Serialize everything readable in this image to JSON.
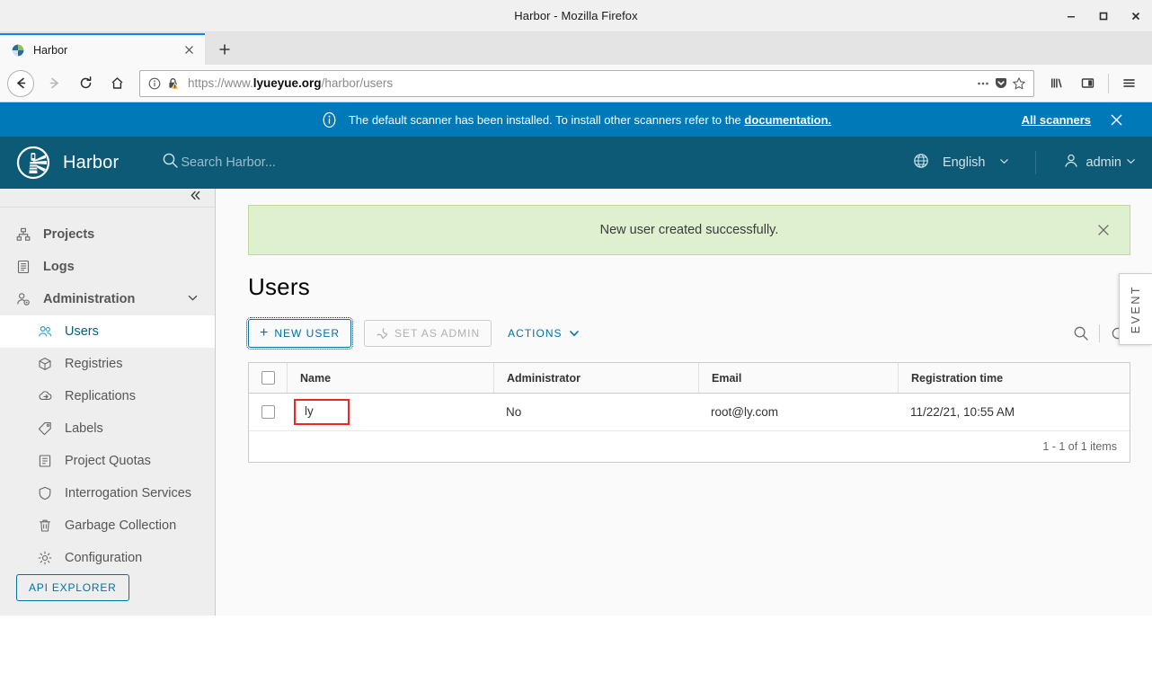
{
  "browser": {
    "window_title": "Harbor - Mozilla Firefox",
    "tab_label": "Harbor",
    "url_scheme": "https://www.",
    "url_host": "lyueyue.org",
    "url_path": "/harbor/users",
    "controls": {
      "minimize": "minimize-icon",
      "maximize": "maximize-icon",
      "close": "close-icon"
    },
    "nav": {
      "back": "back-arrow-icon",
      "forward": "forward-arrow-icon",
      "reload": "reload-icon",
      "home": "home-icon",
      "page_info": "info-icon",
      "lock_warning": "lock-warning-icon",
      "page_actions": "ellipsis-icon",
      "pocket": "pocket-icon",
      "bookmark": "star-icon",
      "library": "library-icon",
      "sidebar": "sidebar-icon",
      "menu": "hamburger-menu-icon"
    },
    "new_tab": "plus-icon",
    "tab_close": "close-icon"
  },
  "banner": {
    "message_prefix": "The default scanner has been installed. To install other scanners refer to the ",
    "link_text": "documentation.",
    "all_scanners": "All scanners",
    "close": "close-icon",
    "icon": "info-circle-icon",
    "bg_color": "#0079b8"
  },
  "header": {
    "brand": "Harbor",
    "logo": "harbor-lighthouse-logo",
    "search_placeholder": "Search Harbor...",
    "search_icon": "search-icon",
    "language": "English",
    "language_icon": "globe-icon",
    "language_chevron": "chevron-down-icon",
    "user": "admin",
    "user_icon": "user-icon",
    "user_chevron": "chevron-down-icon",
    "bg_color": "#0d5a76"
  },
  "event_tab": {
    "label": "EVENT"
  },
  "sidebar": {
    "collapse_icon": "double-chevron-left-icon",
    "items": [
      {
        "label": "Projects",
        "icon": "projects-icon",
        "level": "top",
        "active": false
      },
      {
        "label": "Logs",
        "icon": "logs-icon",
        "level": "top",
        "active": false
      },
      {
        "label": "Administration",
        "icon": "administration-icon",
        "level": "top",
        "active": false,
        "expanded": true,
        "chevron": "chevron-down-icon"
      },
      {
        "label": "Users",
        "icon": "users-icon",
        "level": "sub",
        "active": true
      },
      {
        "label": "Registries",
        "icon": "registries-icon",
        "level": "sub",
        "active": false
      },
      {
        "label": "Replications",
        "icon": "replications-icon",
        "level": "sub",
        "active": false
      },
      {
        "label": "Labels",
        "icon": "labels-tag-icon",
        "level": "sub",
        "active": false
      },
      {
        "label": "Project Quotas",
        "icon": "project-quotas-icon",
        "level": "sub",
        "active": false
      },
      {
        "label": "Interrogation Services",
        "icon": "shield-icon",
        "level": "sub",
        "active": false
      },
      {
        "label": "Garbage Collection",
        "icon": "trash-icon",
        "level": "sub",
        "active": false
      },
      {
        "label": "Configuration",
        "icon": "gear-icon",
        "level": "sub",
        "active": false
      }
    ],
    "api_explorer": "API EXPLORER"
  },
  "alert": {
    "message": "New user created successfully.",
    "close": "close-icon",
    "bg_color": "#dff0d0"
  },
  "page": {
    "title": "Users"
  },
  "toolbar": {
    "new_user": "NEW USER",
    "new_user_icon": "plus-icon",
    "set_as_admin": "SET AS ADMIN",
    "set_as_admin_icon": "wrench-icon",
    "actions": "ACTIONS",
    "actions_chevron": "chevron-down-icon",
    "search_icon": "search-icon",
    "refresh_icon": "refresh-icon"
  },
  "table": {
    "select_all": "select-all-checkbox",
    "columns": [
      "Name",
      "Administrator",
      "Email",
      "Registration time"
    ],
    "rows": [
      {
        "name": "ly",
        "administrator": "No",
        "email": "root@ly.com",
        "registration_time": "11/22/21, 10:55 AM",
        "highlighted": true
      }
    ],
    "footer": "1 - 1 of 1 items",
    "highlight_color": "#f22424"
  }
}
